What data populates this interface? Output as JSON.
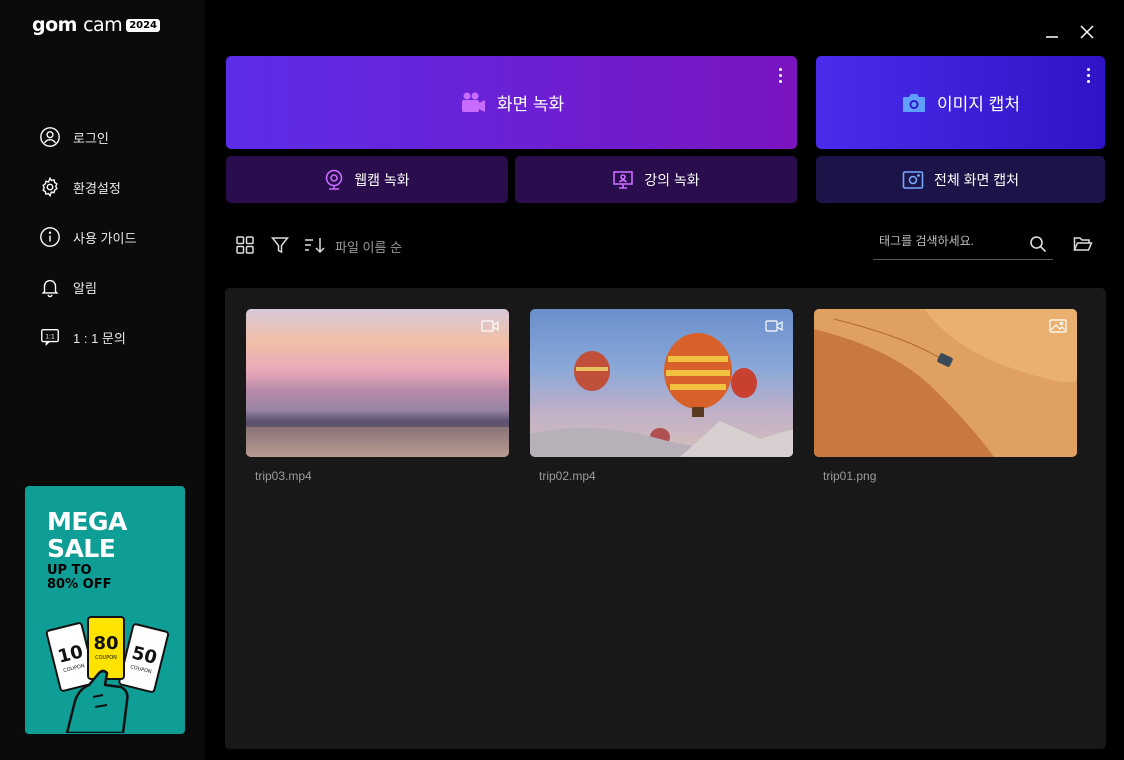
{
  "app": {
    "logo_main": "gom",
    "logo_light": "cam",
    "logo_badge": "2024"
  },
  "sidebar": {
    "items": [
      {
        "label": "로그인",
        "icon": "user-circle-icon"
      },
      {
        "label": "환경설정",
        "icon": "gear-icon"
      },
      {
        "label": "사용 가이드",
        "icon": "info-icon"
      },
      {
        "label": "알림",
        "icon": "bell-icon"
      },
      {
        "label": "1 : 1 문의",
        "icon": "chat-1to1-icon"
      }
    ],
    "promo": {
      "title_line1": "MEGA",
      "title_line2": "SALE",
      "sub_line1": "UP TO",
      "sub_line2": "80% OFF",
      "coupon_values": [
        "10",
        "80",
        "50"
      ],
      "coupon_word": "COUPON",
      "bg_color": "#0f9e96"
    }
  },
  "actions": {
    "screen_record": "화면 녹화",
    "image_capture": "이미지 캡처",
    "webcam_record": "웹캠 녹화",
    "lecture_record": "강의 녹화",
    "full_capture": "전체 화면 캡처"
  },
  "toolbar": {
    "sort_label": "파일 이름 순",
    "search_placeholder": "태그를 검색하세요."
  },
  "files": [
    {
      "name": "trip03.mp4",
      "type": "video-icon"
    },
    {
      "name": "trip02.mp4",
      "type": "video-icon"
    },
    {
      "name": "trip01.png",
      "type": "image-icon"
    }
  ]
}
